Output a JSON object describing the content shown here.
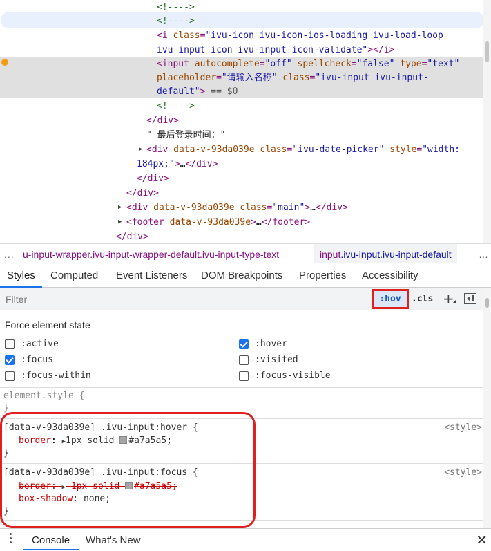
{
  "elements_tree": {
    "lines": [
      {
        "html_parts": [
          [
            "cmt",
            "<!---->"
          ]
        ]
      },
      {
        "html_parts": [
          [
            "cmt",
            "<!---->"
          ]
        ]
      },
      {
        "html_parts": [
          [
            "tag",
            "<i "
          ],
          [
            "attr",
            "class"
          ],
          [
            "tag",
            "="
          ],
          [
            "val",
            "\"ivu-icon ivu-icon-ios-loading ivu-load-loop"
          ]
        ]
      },
      {
        "html_parts": [
          [
            "val",
            "ivu-input-icon ivu-input-icon-validate\""
          ],
          [
            "tag",
            "></i>"
          ]
        ]
      },
      {
        "html_parts": [
          [
            "tag",
            "<input "
          ],
          [
            "attr",
            "autocomplete"
          ],
          [
            "tag",
            "="
          ],
          [
            "val",
            "\"off\" "
          ],
          [
            "attr",
            "spellcheck"
          ],
          [
            "tag",
            "="
          ],
          [
            "val",
            "\"false\" "
          ],
          [
            "attr",
            "type"
          ],
          [
            "tag",
            "="
          ],
          [
            "val",
            "\"text\""
          ]
        ]
      },
      {
        "html_parts": [
          [
            "attr",
            "placeholder"
          ],
          [
            "tag",
            "="
          ],
          [
            "val",
            "\"请输入名称\" "
          ],
          [
            "attr",
            "class"
          ],
          [
            "tag",
            "="
          ],
          [
            "val",
            "\"ivu-input ivu-input-"
          ]
        ]
      },
      {
        "html_parts": [
          [
            "val",
            "default\""
          ],
          [
            "tag",
            "> "
          ],
          [
            "dim",
            "== "
          ],
          [
            "dim",
            "$0"
          ]
        ]
      },
      {
        "html_parts": [
          [
            "cmt",
            "<!---->"
          ]
        ]
      },
      {
        "html_parts": [
          [
            "tag",
            "</div>"
          ]
        ]
      },
      {
        "html_parts": [
          [
            "txt",
            "\" 最后登录时间：\""
          ]
        ]
      },
      {
        "html_parts": [
          [
            "tag",
            "<div "
          ],
          [
            "attr",
            "data-v-93da039e "
          ],
          [
            "attr",
            "class"
          ],
          [
            "tag",
            "="
          ],
          [
            "val",
            "\"ivu-date-picker\" "
          ],
          [
            "attr",
            "style"
          ],
          [
            "tag",
            "="
          ],
          [
            "val",
            "\"width:"
          ]
        ]
      },
      {
        "html_parts": [
          [
            "val",
            "184px;\""
          ],
          [
            "tag",
            ">"
          ],
          [
            "txt",
            "…"
          ],
          [
            "tag",
            "</div>"
          ]
        ]
      },
      {
        "html_parts": [
          [
            "tag",
            "</div>"
          ]
        ]
      },
      {
        "html_parts": [
          [
            "tag",
            "</div>"
          ]
        ]
      },
      {
        "html_parts": [
          [
            "tag",
            "<div "
          ],
          [
            "attr",
            "data-v-93da039e "
          ],
          [
            "attr",
            "class"
          ],
          [
            "tag",
            "="
          ],
          [
            "val",
            "\"main\""
          ],
          [
            "tag",
            ">"
          ],
          [
            "txt",
            "…"
          ],
          [
            "tag",
            "</div>"
          ]
        ]
      },
      {
        "html_parts": [
          [
            "tag",
            "<footer "
          ],
          [
            "attr",
            "data-v-93da039e"
          ],
          [
            "tag",
            ">"
          ],
          [
            "txt",
            "…"
          ],
          [
            "tag",
            "</footer>"
          ]
        ]
      },
      {
        "html_parts": [
          [
            "tag",
            "</div>"
          ]
        ]
      }
    ]
  },
  "breadcrumb": {
    "dots": "...",
    "item1": "u-input-wrapper.ivu-input-wrapper-default.ivu-input-type-text",
    "item2_tag": "input",
    "item2_rest": ".ivu-input.ivu-input-default"
  },
  "tabs": [
    "Styles",
    "Computed",
    "Event Listeners",
    "DOM Breakpoints",
    "Properties",
    "Accessibility"
  ],
  "filter": {
    "placeholder": "Filter",
    "hov": ":hov",
    "cls": ".cls",
    "plus": "+"
  },
  "force_state": {
    "title": "Force element state",
    "left": [
      {
        "label": ":active",
        "checked": false
      },
      {
        "label": ":focus",
        "checked": true
      },
      {
        "label": ":focus-within",
        "checked": false
      }
    ],
    "right": [
      {
        "label": ":hover",
        "checked": true
      },
      {
        "label": ":visited",
        "checked": false
      },
      {
        "label": ":focus-visible",
        "checked": false
      }
    ]
  },
  "rules": {
    "element_style": {
      "selector": "element.style {",
      "close": "}"
    },
    "hover_rule": {
      "selector": "[data-v-93da039e] .ivu-input:hover {",
      "source": "<style>",
      "prop": "border",
      "value": "1px solid ",
      "color": "#a7a5a5",
      "close": "}"
    },
    "focus_rule": {
      "selector": "[data-v-93da039e] .ivu-input:focus {",
      "source": "<style>",
      "prop1": "border",
      "value1": "1px solid ",
      "color1": "#a7a5a5",
      "prop2": "box-shadow",
      "value2": "none;",
      "close": "}"
    }
  },
  "drawer": {
    "tabs": [
      "Console",
      "What's New"
    ],
    "close": "✕"
  }
}
